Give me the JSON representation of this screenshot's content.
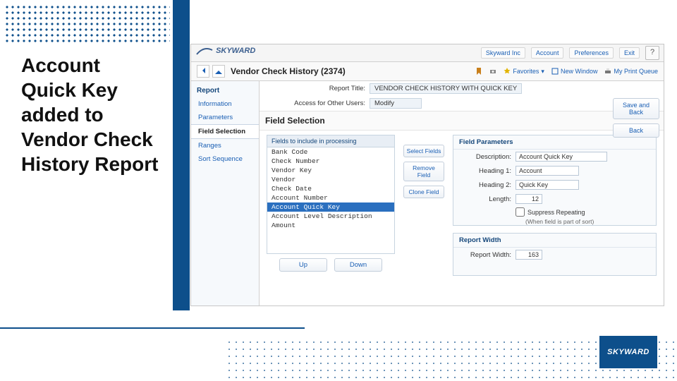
{
  "headline": "Account Quick Key added to Vendor Check History Report",
  "brand": "SKYWARD",
  "topbar": {
    "links": [
      "Skyward Inc",
      "Account",
      "Preferences",
      "Exit"
    ],
    "help": "?"
  },
  "titlebar": {
    "title": "Vendor Check History (2374)",
    "tools": {
      "favorites": "Favorites",
      "newwin": "New Window",
      "printq": "My Print Queue"
    }
  },
  "sidebar": {
    "header": "Report",
    "items": [
      "Information",
      "Parameters",
      "Field Selection",
      "Ranges",
      "Sort Sequence"
    ],
    "selected": 2
  },
  "header_rows": {
    "report_title_lbl": "Report Title:",
    "report_title_val": "VENDOR CHECK HISTORY WITH QUICK KEY",
    "access_lbl": "Access for Other Users:",
    "access_val": "Modify"
  },
  "section_title": "Field Selection",
  "right_buttons": [
    "Save and Back",
    "Back"
  ],
  "fields_header": "Fields to include in processing",
  "field_list": [
    "Bank Code",
    "Check Number",
    "Vendor Key",
    "Vendor",
    "Check Date",
    "Account Number",
    "Account Quick Key",
    "Account Level Description",
    "Amount"
  ],
  "field_selected_index": 6,
  "mid_buttons": [
    "Select Fields",
    "Remove Field",
    "Clone Field"
  ],
  "params": {
    "header": "Field Parameters",
    "description_lbl": "Description:",
    "description_val": "Account Quick Key",
    "h1_lbl": "Heading 1:",
    "h1_val": "Account",
    "h2_lbl": "Heading 2:",
    "h2_val": "Quick Key",
    "len_lbl": "Length:",
    "len_val": "12",
    "suppress_lbl": "Suppress Repeating",
    "suppress_note": "(When field is part of sort)"
  },
  "report_width": {
    "header": "Report Width",
    "lbl": "Report Width:",
    "val": "163"
  },
  "bottom_buttons": [
    "Up",
    "Down"
  ]
}
